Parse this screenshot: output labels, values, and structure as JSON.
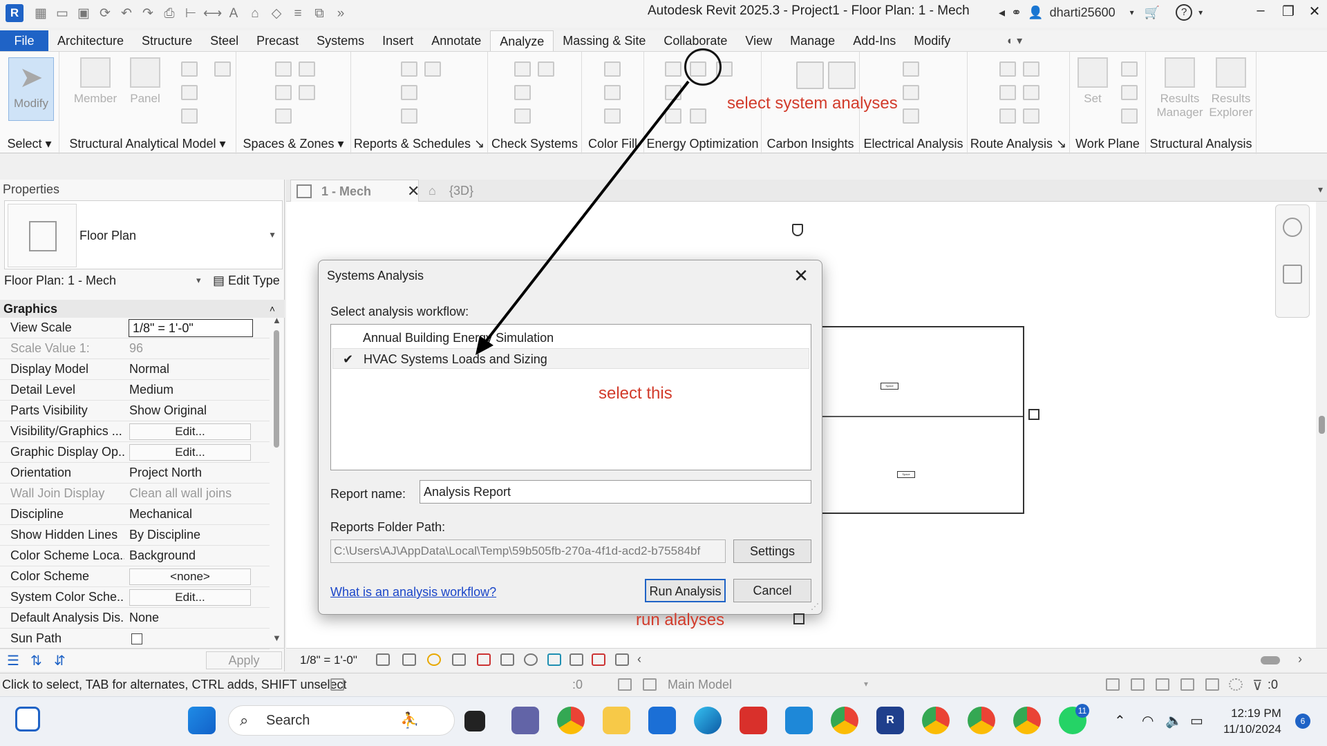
{
  "titlebar": {
    "logo": "R",
    "window_title": "Autodesk Revit 2025.3 - Project1 - Floor Plan: 1 - Mech",
    "user_name": "dharti25600",
    "help_label": "?"
  },
  "menu": {
    "file": "File",
    "tabs": [
      "Architecture",
      "Structure",
      "Steel",
      "Precast",
      "Systems",
      "Insert",
      "Annotate",
      "Analyze",
      "Massing & Site",
      "Collaborate",
      "View",
      "Manage",
      "Add-Ins",
      "Modify"
    ],
    "active_tab": "Analyze"
  },
  "ribbon": {
    "modify": "Modify",
    "member": "Member",
    "panel": "Panel",
    "set": "Set",
    "results_manager": [
      "Results",
      "Manager"
    ],
    "results_explorer": [
      "Results",
      "Explorer"
    ],
    "panel_labels": [
      "Select",
      "Structural Analytical Model",
      "Spaces & Zones",
      "Reports & Schedules",
      "Check Systems",
      "Color Fill",
      "Energy Optimization",
      "Carbon Insights",
      "Electrical Analysis",
      "Route Analysis",
      "Work Plane",
      "Structural Analysis"
    ]
  },
  "annotations": {
    "select_system": "select system analyses",
    "select_this": "select this",
    "run_analyses": "run alalyses"
  },
  "properties": {
    "title": "Properties",
    "type_name": "Floor Plan",
    "instance": "Floor Plan: 1 - Mech",
    "edit_type": "Edit Type",
    "group": "Graphics",
    "rows": [
      {
        "name": "View Scale",
        "value": "1/8\" = 1'-0\""
      },
      {
        "name": "Scale Value    1:",
        "value": "96"
      },
      {
        "name": "Display Model",
        "value": "Normal"
      },
      {
        "name": "Detail Level",
        "value": "Medium"
      },
      {
        "name": "Parts Visibility",
        "value": "Show Original"
      },
      {
        "name": "Visibility/Graphics ...",
        "value": "Edit..."
      },
      {
        "name": "Graphic Display Op...",
        "value": "Edit..."
      },
      {
        "name": "Orientation",
        "value": "Project North"
      },
      {
        "name": "Wall Join Display",
        "value": "Clean all wall joins"
      },
      {
        "name": "Discipline",
        "value": "Mechanical"
      },
      {
        "name": "Show Hidden Lines",
        "value": "By Discipline"
      },
      {
        "name": "Color Scheme Loca...",
        "value": "Background"
      },
      {
        "name": "Color Scheme",
        "value": "<none>"
      },
      {
        "name": "System Color Sche...",
        "value": "Edit..."
      },
      {
        "name": "Default Analysis Dis...",
        "value": "None"
      },
      {
        "name": "Sun Path",
        "value": ""
      }
    ],
    "apply": "Apply"
  },
  "view_tabs": {
    "active": "1 - Mech",
    "inactive": "{3D}"
  },
  "view_control": {
    "scale": "1/8\" = 1'-0\""
  },
  "canvas": {
    "space_label": "Space"
  },
  "status": {
    "hint": "Click to select, TAB for alternates, CTRL adds, SHIFT unselect",
    "zero1": ":0",
    "main_model": "Main Model",
    "zero2": ":0"
  },
  "dialog": {
    "title": "Systems Analysis",
    "workflow_label": "Select analysis workflow:",
    "workflows": [
      {
        "label": "Annual Building Energy Simulation",
        "checked": false
      },
      {
        "label": "HVAC Systems Loads and Sizing",
        "checked": true
      }
    ],
    "check_glyph": "✔",
    "report_name_label": "Report name:",
    "report_name_value": "Analysis Report",
    "folder_label": "Reports Folder Path:",
    "folder_value": "C:\\Users\\AJ\\AppData\\Local\\Temp\\59b505fb-270a-4f1d-acd2-b75584bf",
    "settings": "Settings",
    "link": "What is an analysis workflow?",
    "run": "Run Analysis",
    "cancel": "Cancel"
  },
  "taskbar": {
    "search": "Search",
    "time": "12:19 PM",
    "date": "11/10/2024",
    "notif_count": "6",
    "whatsapp_badge": "11"
  },
  "colors": {
    "accent": "#1f63c6",
    "annotation_red": "#d23b2b",
    "link": "#1a46c9"
  }
}
